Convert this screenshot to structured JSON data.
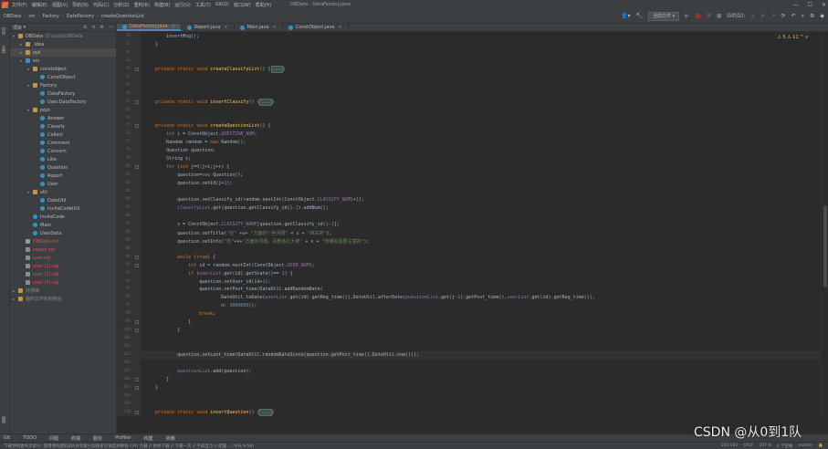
{
  "menu": {
    "items": [
      "文件(F)",
      "编辑(E)",
      "视图(V)",
      "导航(N)",
      "代码(C)",
      "分析(Z)",
      "重构(R)",
      "构建(B)",
      "运行(U)",
      "工具(T)",
      "Git(G)",
      "窗口(W)",
      "帮助(H)"
    ],
    "window_title": "DBData - DataFactory.java"
  },
  "nav": {
    "breadcrumbs": [
      "DBData",
      "src",
      "Factory",
      "DataFactory",
      "createQuestionList"
    ],
    "run_config": "当前文件",
    "git_label": "Git(G):"
  },
  "project": {
    "header": "项目",
    "tree": [
      {
        "label": "DBData",
        "path": "D:\\code\\DBData",
        "depth": 0,
        "icon": "folder",
        "expanded": true
      },
      {
        "label": ".idea",
        "depth": 1,
        "icon": "folder"
      },
      {
        "label": "out",
        "depth": 1,
        "icon": "folder",
        "selected": true
      },
      {
        "label": "src",
        "depth": 1,
        "icon": "src",
        "expanded": true
      },
      {
        "label": "constobject",
        "depth": 2,
        "icon": "folder",
        "expanded": true
      },
      {
        "label": "ConstObject",
        "depth": 3,
        "icon": "class"
      },
      {
        "label": "Factory",
        "depth": 2,
        "icon": "folder",
        "expanded": true
      },
      {
        "label": "DataFactory",
        "depth": 3,
        "icon": "class"
      },
      {
        "label": "User.DataFactory",
        "depth": 3,
        "icon": "class"
      },
      {
        "label": "pojo",
        "depth": 2,
        "icon": "folder",
        "expanded": true
      },
      {
        "label": "Answer",
        "depth": 3,
        "icon": "class"
      },
      {
        "label": "Classify",
        "depth": 3,
        "icon": "class"
      },
      {
        "label": "Collect",
        "depth": 3,
        "icon": "class"
      },
      {
        "label": "Comment",
        "depth": 3,
        "icon": "class"
      },
      {
        "label": "Concern",
        "depth": 3,
        "icon": "class"
      },
      {
        "label": "Like",
        "depth": 3,
        "icon": "class"
      },
      {
        "label": "Question",
        "depth": 3,
        "icon": "class"
      },
      {
        "label": "Report",
        "depth": 3,
        "icon": "class"
      },
      {
        "label": "User",
        "depth": 3,
        "icon": "class"
      },
      {
        "label": "util",
        "depth": 2,
        "icon": "folder",
        "expanded": true
      },
      {
        "label": "DateUtil",
        "depth": 3,
        "icon": "class"
      },
      {
        "label": "InviteCodeUtil",
        "depth": 3,
        "icon": "class"
      },
      {
        "label": "InviteCode",
        "depth": 2,
        "icon": "class"
      },
      {
        "label": "Main",
        "depth": 2,
        "icon": "class"
      },
      {
        "label": "UserData",
        "depth": 2,
        "icon": "class"
      },
      {
        "label": "DBData.iml",
        "depth": 1,
        "icon": "file",
        "red": true
      },
      {
        "label": "report.sql",
        "depth": 1,
        "icon": "txt",
        "red": true
      },
      {
        "label": "user.sql",
        "depth": 1,
        "icon": "txt",
        "red": true
      },
      {
        "label": "user (1).sql",
        "depth": 1,
        "icon": "txt",
        "red": true
      },
      {
        "label": "user (2).sql",
        "depth": 1,
        "icon": "txt",
        "red": true
      },
      {
        "label": "user (3).sql",
        "depth": 1,
        "icon": "txt",
        "red": true
      },
      {
        "label": "外部库",
        "depth": 0,
        "icon": "folder",
        "dim": true
      },
      {
        "label": "临时文件和控制台",
        "depth": 0,
        "icon": "folder",
        "dim": true
      }
    ],
    "strip_labels": [
      "项目",
      "提交",
      "结构"
    ]
  },
  "tabs": [
    {
      "label": "DataFactory.java",
      "active": true
    },
    {
      "label": "Report.java",
      "active": false
    },
    {
      "label": "Main.java",
      "active": false
    },
    {
      "label": "ConstObject.java",
      "active": false
    }
  ],
  "editor": {
    "warnings": "⚠ 5  ⚠ 11  ^  v",
    "lines": [
      {
        "n": "30",
        "t": "        insertMsg();"
      },
      {
        "n": "31",
        "t": "    }"
      },
      {
        "n": "32",
        "t": ""
      },
      {
        "n": "33",
        "t": ""
      },
      {
        "n": "36",
        "t": "    private static void createClassifyList() {...}"
      },
      {
        "n": "37",
        "t": ""
      },
      {
        "n": "45",
        "t": ""
      },
      {
        "n": "46",
        "t": ""
      },
      {
        "n": "57",
        "t": "    private static void insertClassify() {...}"
      },
      {
        "n": "58",
        "t": ""
      },
      {
        "n": "74",
        "t": ""
      },
      {
        "n": "75",
        "t": "    private static void createQuestionList() {"
      },
      {
        "n": "76",
        "t": "        int i = ConstObject.QUESTION_NUM;"
      },
      {
        "n": "77",
        "t": "        Random random = new Random();"
      },
      {
        "n": "78",
        "t": "        Question question;"
      },
      {
        "n": "79",
        "t": "        String s;"
      },
      {
        "n": "80",
        "t": "        for (int j=0;j<i;j++) {"
      },
      {
        "n": "81",
        "t": "            question=new Question();"
      },
      {
        "n": "82",
        "t": "            question.setId(j+1);"
      },
      {
        "n": "83",
        "t": ""
      },
      {
        "n": "84",
        "t": "            question.setClassify_id(random.nextInt(ConstObject.CLASSIFY_NUM)+1);"
      },
      {
        "n": "85",
        "t": "            classifyList.get(question.getClassify_id()-1).addNum();"
      },
      {
        "n": "86",
        "t": ""
      },
      {
        "n": "87",
        "t": "            s = ConstObject.CLASSIFY_NAME[question.getClassify_id()-1];"
      },
      {
        "n": "88",
        "t": "            question.setTitle(\"在\" +s+ \"方面的一些问题\" + s + \"相关的\");"
      },
      {
        "n": "89",
        "t": "            question.setInfo(\"有\"+s+\"方面的问题，请教各位大佬\" + s + \"有哪些需要注意的\");"
      },
      {
        "n": "90",
        "t": ""
      },
      {
        "n": "91",
        "t": "            while (true) {"
      },
      {
        "n": "92",
        "t": "                int id = random.nextInt(ConstObject.USER_NUM);"
      },
      {
        "n": "93",
        "t": "                if (userList.get(id).getState()== 1) {"
      },
      {
        "n": "94",
        "t": "                    question.setUser_id(id+1);"
      },
      {
        "n": "95",
        "t": "                    question.setPost_time(DateUtil.addRandomDate("
      },
      {
        "n": "96",
        "t": "                            DateUtil.toDate(userList.get(id).getReg_time()),DateUtil.afterDate(questionList.get(j-1).getPost_time(),userList.get(id).getReg_time()),"
      },
      {
        "n": "97",
        "t": "                            n: 1000000));"
      },
      {
        "n": "98",
        "t": "                    break;"
      },
      {
        "n": "99",
        "t": "                }"
      },
      {
        "n": "100",
        "t": "            }"
      },
      {
        "n": "101",
        "t": ""
      },
      {
        "n": "102",
        "t": ""
      },
      {
        "n": "103",
        "t": "            question.setLast_time(DateUtil.randomDateSince(question.getPost_time(),DateUtil.now()));"
      },
      {
        "n": "104",
        "t": ""
      },
      {
        "n": "105",
        "t": "            questionList.add(question);"
      },
      {
        "n": "106",
        "t": "        }"
      },
      {
        "n": "107",
        "t": "    }"
      },
      {
        "n": "108",
        "t": ""
      },
      {
        "n": "109",
        "t": ""
      },
      {
        "n": "110",
        "t": "    private static void insertQuestion() {...}"
      }
    ]
  },
  "bottom_tools": [
    "Git",
    "TODO",
    "问题",
    "终端",
    "服务",
    "Profiler",
    "构建",
    "依赖"
  ],
  "status": {
    "message": "下载预构建共享索引: 使用预构建的JDK共享索引加快索引速度并降低 CPU 负载 // 始终下载 // 下载一次 // 不再显示 // 配置... (今天 9:58)",
    "position": "103:103",
    "line_sep": "CRLF",
    "encoding": "UTF-8",
    "indent": "4 个空格",
    "branch": "master"
  },
  "watermark": "CSDN @从0到1队",
  "colors": {
    "accent": "#4a88c7",
    "keyword": "#cc7832",
    "method": "#ffc66d",
    "string": "#6a8759",
    "field": "#9876aa",
    "error_file": "#d25252"
  }
}
